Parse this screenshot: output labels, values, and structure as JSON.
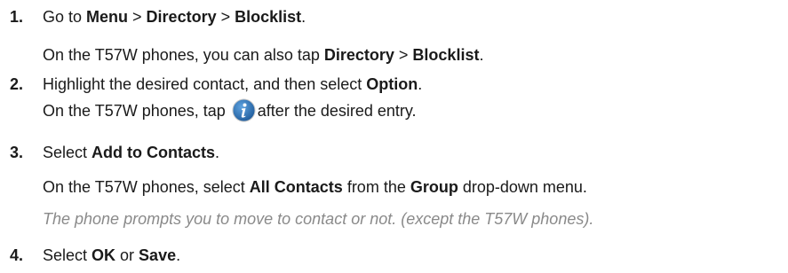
{
  "steps": [
    {
      "number": "1.",
      "lines": [
        {
          "pre": "Go to ",
          "b1": "Menu",
          "mid1": " > ",
          "b2": "Directory",
          "mid2": " > ",
          "b3": "Blocklist",
          "post": "."
        },
        {
          "pre": "On the T57W phones, you can also tap ",
          "b1": "Directory",
          "mid1": " > ",
          "b2": "Blocklist",
          "post": "."
        }
      ]
    },
    {
      "number": "2.",
      "lines": [
        {
          "pre": "Highlight the desired contact, and then select ",
          "b1": "Option",
          "post": "."
        },
        {
          "pre": "On the T57W phones, tap ",
          "icon": "info-icon",
          "post": "after the desired entry."
        }
      ]
    },
    {
      "number": "3.",
      "lines": [
        {
          "pre": "Select ",
          "b1": "Add to Contacts",
          "post": "."
        },
        {
          "pre": "On the T57W phones, select ",
          "b1": "All Contacts",
          "mid1": " from the ",
          "b2": "Group",
          "post": " drop-down menu."
        },
        {
          "note": "The phone prompts you to move to contact or not. (except the T57W phones)."
        }
      ]
    },
    {
      "number": "4.",
      "lines": [
        {
          "pre": "Select ",
          "b1": "OK",
          "mid1": " or ",
          "b2": "Save",
          "post": "."
        }
      ]
    }
  ],
  "colors": {
    "text": "#1a1a1a",
    "note": "#8a8a8a",
    "icon_fill": "#2b6fb3"
  }
}
